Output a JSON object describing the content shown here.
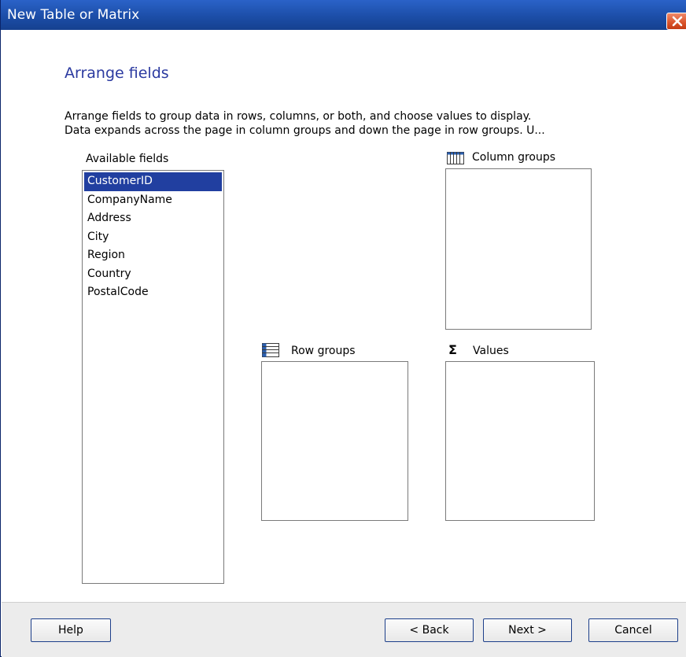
{
  "window": {
    "title": "New Table or Matrix",
    "close_glyph": "✕"
  },
  "page": {
    "heading": "Arrange fields",
    "description_line1": "Arrange fields to group data in rows, columns, or both, and choose values to display.",
    "description_line2": "Data expands across the page in column groups and down the page in row groups.  U..."
  },
  "available_fields": {
    "label": "Available fields",
    "items": [
      "CustomerID",
      "CompanyName",
      "Address",
      "City",
      "Region",
      "Country",
      "PostalCode"
    ],
    "selected_index": 0
  },
  "column_groups": {
    "label": "Column groups",
    "icon": "column-groups-icon"
  },
  "row_groups": {
    "label": "Row groups",
    "icon": "row-groups-icon"
  },
  "values": {
    "label": "Values",
    "icon": "sigma-icon",
    "glyph": "Σ"
  },
  "footer": {
    "help_label": "Help",
    "back_label": "< Back",
    "next_label": "Next >",
    "cancel_label": "Cancel"
  },
  "colors": {
    "titlebar": "#1c4ea8",
    "heading": "#2b3aa0",
    "selection": "#213fa0",
    "close_button": "#d9532a"
  }
}
